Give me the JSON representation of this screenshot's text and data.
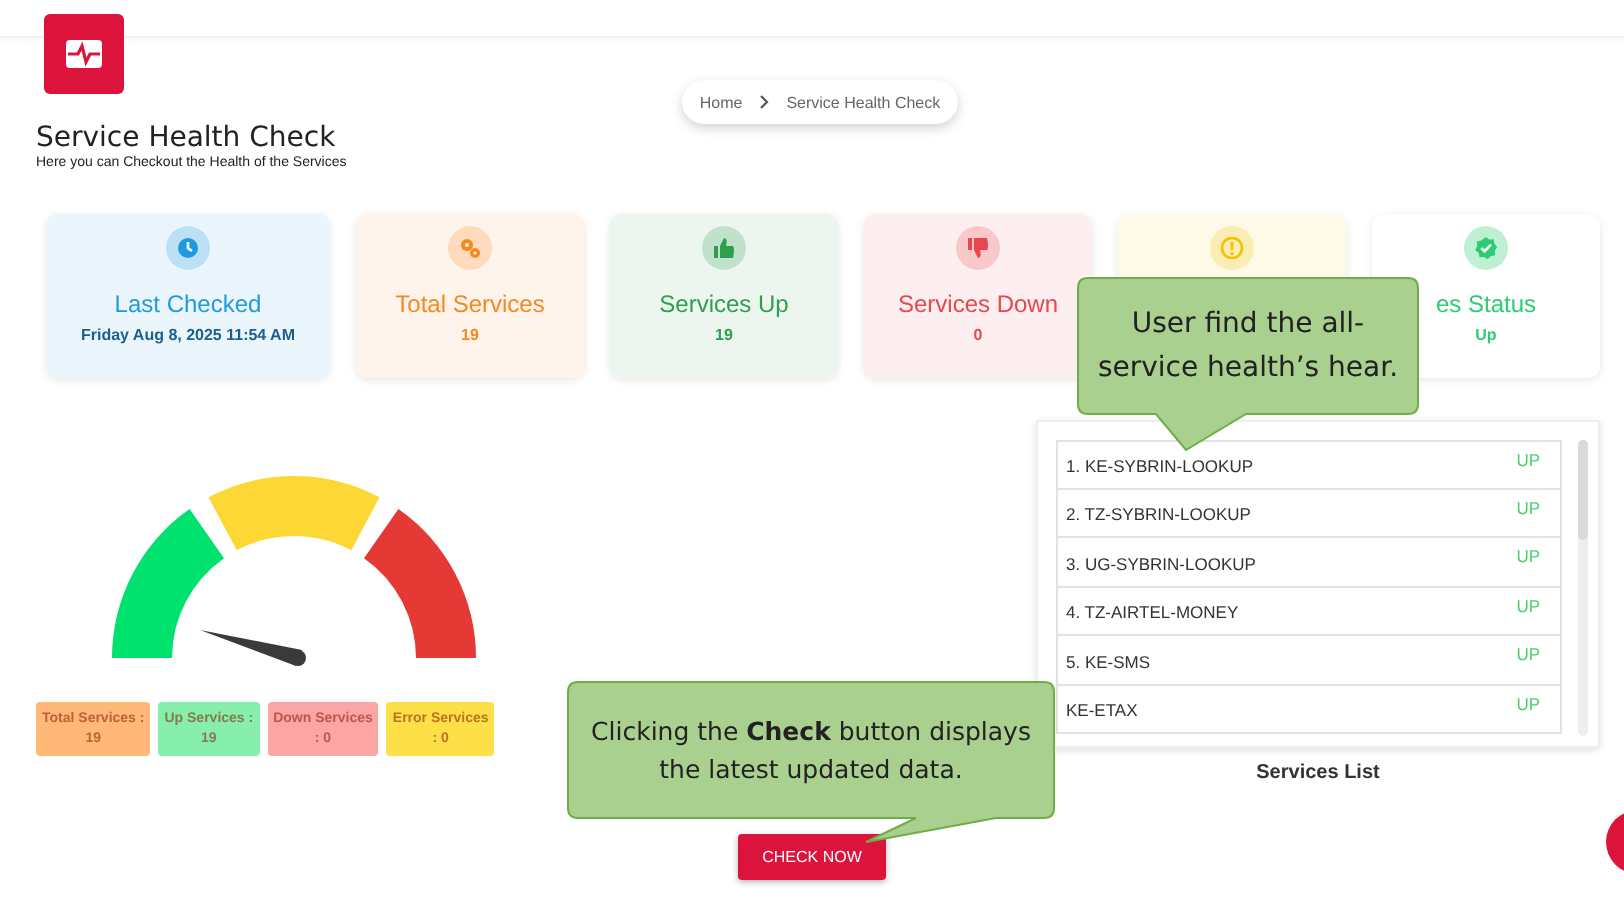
{
  "breadcrumb": {
    "home": "Home",
    "current": "Service Health Check"
  },
  "page": {
    "title": "Service Health Check",
    "subtitle": "Here you can Checkout the Health of the Services"
  },
  "cards": [
    {
      "kind": "last_checked",
      "color": "#1e9be0",
      "title": "Last Checked",
      "value": "Friday Aug 8, 2025 11:54 AM"
    },
    {
      "kind": "total",
      "color": "#f7871f",
      "title": "Total Services",
      "value": "19"
    },
    {
      "kind": "up",
      "color": "#2e9e4f",
      "title": "Services Up",
      "value": "19"
    },
    {
      "kind": "down",
      "color": "#e8474f",
      "title": "Services Down",
      "value": "0"
    },
    {
      "kind": "error",
      "color": "#f2c200"
    },
    {
      "kind": "status",
      "color": "#2ecc71",
      "title": "es Status",
      "value": "Up"
    }
  ],
  "legend": [
    {
      "label": "Total Services :",
      "value": "19",
      "color": "#ffb877"
    },
    {
      "label": "Up Services :",
      "value": "19",
      "color": "#86efac"
    },
    {
      "label": "Down Services",
      "value": ": 0",
      "color": "#fca5a5"
    },
    {
      "label": "Error Services",
      "value": ": 0",
      "color": "#fde047"
    }
  ],
  "services": {
    "title": "Services List",
    "rows": [
      {
        "name": "1. KE-SYBRIN-LOOKUP",
        "status": "UP"
      },
      {
        "name": "2. TZ-SYBRIN-LOOKUP",
        "status": "UP"
      },
      {
        "name": "3. UG-SYBRIN-LOOKUP",
        "status": "UP"
      },
      {
        "name": "4. TZ-AIRTEL-MONEY",
        "status": "UP"
      },
      {
        "name": "5. KE-SMS",
        "status": "UP"
      },
      {
        "name": "KE-ETAX",
        "status": "UP"
      }
    ]
  },
  "check_button": "CHECK NOW",
  "callouts": [
    {
      "kind": "top",
      "text": "User find the all-service health’s hear."
    },
    {
      "kind": "bottom",
      "text": "Clicking the **Check** button displays the latest updated data."
    }
  ]
}
